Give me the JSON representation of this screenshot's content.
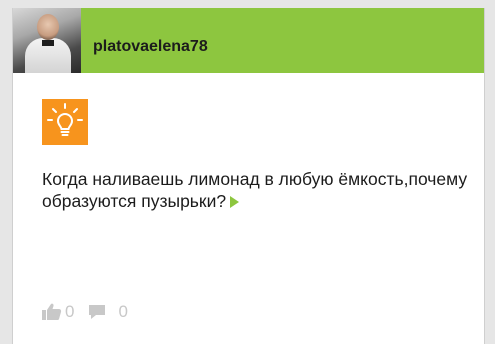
{
  "post": {
    "username": "platovaelena78",
    "question_text": "Когда наливаешь лимонад в любую ёмкость,почему образуются пузырьки?",
    "likes_count": "0",
    "comments_count": "0"
  },
  "icons": {
    "category": "lightbulb-icon",
    "more": "play-arrow-icon",
    "like": "thumbs-up-icon",
    "comment": "comment-icon"
  },
  "colors": {
    "header_bg": "#8dc63f",
    "category_icon_bg": "#f7941d",
    "muted_icons": "#c8c8c8",
    "text": "#1c1c1c"
  }
}
